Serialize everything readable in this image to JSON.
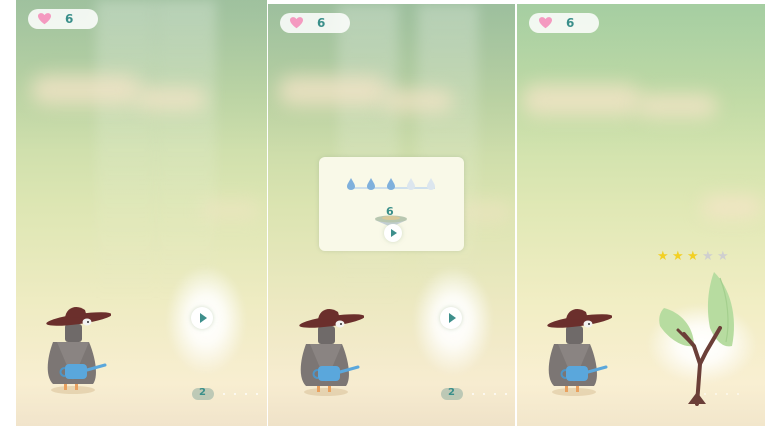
{
  "lives": {
    "count": "6",
    "icon": "heart-icon",
    "color": "#f49ac0"
  },
  "panels": [
    {
      "id": "p1",
      "level": {
        "number": "2"
      }
    },
    {
      "id": "p2",
      "level": {
        "number": "2"
      },
      "result": {
        "score": "6",
        "drops_total": 5,
        "drops_filled": 3
      }
    },
    {
      "id": "p3",
      "rating": {
        "total": 5,
        "filled": 3
      }
    }
  ],
  "colors": {
    "accent": "#3a8f8a",
    "star_gold": "#f2d024",
    "star_gray": "#cfcfcf",
    "drop_blue": "#7fb0dc"
  }
}
